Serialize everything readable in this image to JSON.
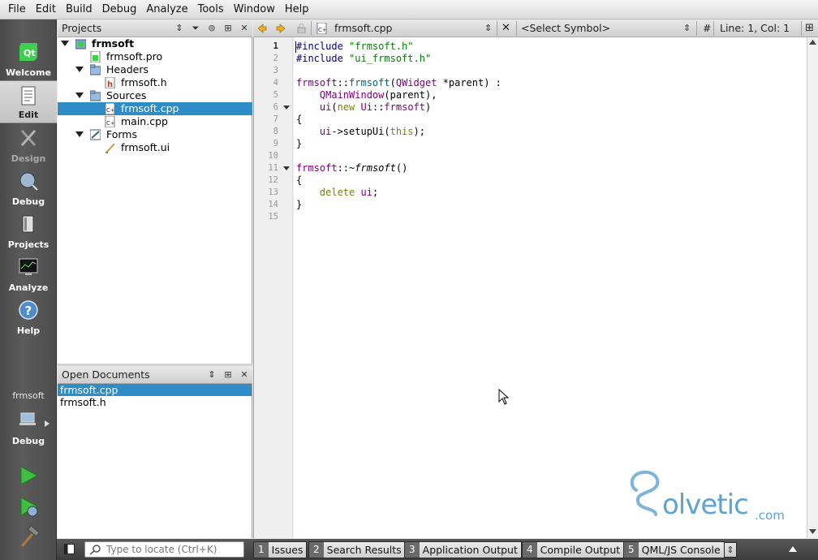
{
  "menu": [
    "File",
    "Edit",
    "Build",
    "Debug",
    "Analyze",
    "Tools",
    "Window",
    "Help"
  ],
  "modes": [
    {
      "label": "Welcome",
      "icon": "qt-logo-icon",
      "state": "normal"
    },
    {
      "label": "Edit",
      "icon": "edit-document-icon",
      "state": "active"
    },
    {
      "label": "Design",
      "icon": "design-tools-icon",
      "state": "disabled"
    },
    {
      "label": "Debug",
      "icon": "debug-bug-icon",
      "state": "normal"
    },
    {
      "label": "Projects",
      "icon": "projects-icon",
      "state": "normal"
    },
    {
      "label": "Analyze",
      "icon": "analyze-monitor-icon",
      "state": "normal"
    },
    {
      "label": "Help",
      "icon": "help-icon",
      "state": "normal"
    }
  ],
  "kit": {
    "project": "frmsoft",
    "config": "Debug"
  },
  "projects": {
    "title": "Projects",
    "tree": [
      {
        "label": "frmsoft",
        "type": "project",
        "bold": true
      },
      {
        "label": "frmsoft.pro",
        "type": "pro"
      },
      {
        "label": "Headers",
        "type": "folder"
      },
      {
        "label": "frmsoft.h",
        "type": "header"
      },
      {
        "label": "Sources",
        "type": "folder"
      },
      {
        "label": "frmsoft.cpp",
        "type": "cpp",
        "selected": true
      },
      {
        "label": "main.cpp",
        "type": "cpp"
      },
      {
        "label": "Forms",
        "type": "folder"
      },
      {
        "label": "frmsoft.ui",
        "type": "ui"
      }
    ]
  },
  "open_documents": {
    "title": "Open Documents",
    "items": [
      {
        "label": "frmsoft.cpp",
        "selected": true
      },
      {
        "label": "frmsoft.h"
      }
    ]
  },
  "editor": {
    "file_name": "frmsoft.cpp",
    "symbol_placeholder": "<Select Symbol>",
    "hash": "#",
    "position": "Line: 1, Col: 1",
    "lines": [
      "1",
      "2",
      "3",
      "4",
      "5",
      "6",
      "7",
      "8",
      "9",
      "10",
      "11",
      "12",
      "13",
      "14",
      "15"
    ]
  },
  "locator": {
    "placeholder": "Type to locate (Ctrl+K)"
  },
  "output_panes": [
    {
      "num": "1",
      "label": "Issues"
    },
    {
      "num": "2",
      "label": "Search Results"
    },
    {
      "num": "3",
      "label": "Application Output"
    },
    {
      "num": "4",
      "label": "Compile Output"
    },
    {
      "num": "5",
      "label": "QML/JS Console"
    }
  ],
  "watermark": {
    "brand": "olvetic",
    "suffix": ".com"
  },
  "colors": {
    "selection": "#308cc6",
    "accent": "#5fa2d3"
  }
}
